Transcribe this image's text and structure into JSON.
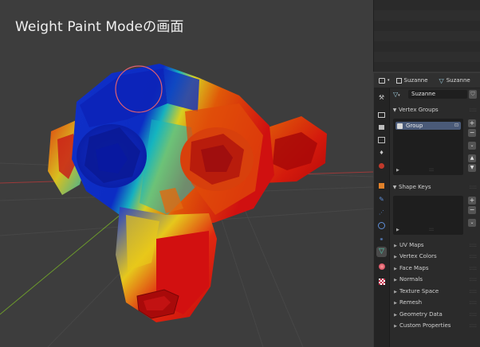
{
  "viewport": {
    "title": "Weight Paint Modeの画面",
    "mode": "Weight Paint Mode"
  },
  "properties": {
    "header": {
      "object_name": "Suzanne",
      "mesh_name": "Suzanne"
    },
    "mesh_datablock": "Suzanne",
    "tabs": [
      "tool",
      "render",
      "output",
      "view-layer",
      "scene",
      "world",
      "object",
      "modifiers",
      "particles",
      "physics",
      "constraints",
      "data",
      "material",
      "texture"
    ],
    "active_tab": "data",
    "vertex_groups": {
      "label": "Vertex Groups",
      "items": [
        {
          "name": "Group"
        }
      ]
    },
    "shape_keys": {
      "label": "Shape Keys"
    },
    "collapsed_panels": [
      "UV Maps",
      "Vertex Colors",
      "Face Maps",
      "Normals",
      "Texture Space",
      "Remesh",
      "Geometry Data",
      "Custom Properties"
    ]
  },
  "colors": {
    "weight_high": "#e01010",
    "weight_mid": "#f2c400",
    "weight_low": "#0a28c8",
    "brush_circle": "#e06070",
    "x_axis": "#9c3a3a",
    "y_axis": "#6c9a2c",
    "accent": "#4a5a78"
  }
}
